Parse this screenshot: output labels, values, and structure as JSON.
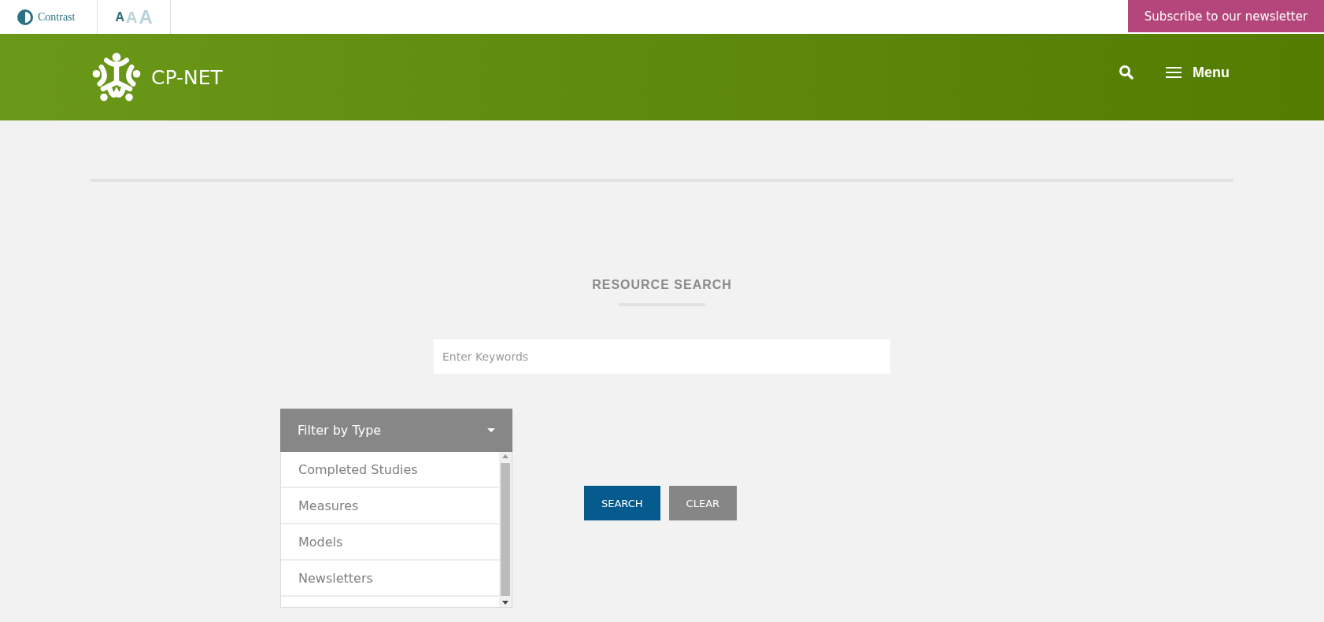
{
  "topbar": {
    "contrast_label": "Contrast",
    "font_sizes": [
      {
        "label": "A",
        "selected": true
      },
      {
        "label": "A",
        "selected": false
      },
      {
        "label": "A",
        "selected": false
      }
    ],
    "subscribe": "Subscribe to our newsletter"
  },
  "header": {
    "logo_text": "CP-NET",
    "menu_label": "Menu"
  },
  "search": {
    "heading": "RESOURCE SEARCH",
    "placeholder": "Enter Keywords"
  },
  "filter": {
    "title": "Filter by Type",
    "items": [
      "Completed Studies",
      "Measures",
      "Models",
      "Newsletters"
    ]
  },
  "buttons": [
    {
      "label": "SEARCH",
      "kind": "primary"
    },
    {
      "label": "CLEAR",
      "kind": "secondary"
    }
  ]
}
